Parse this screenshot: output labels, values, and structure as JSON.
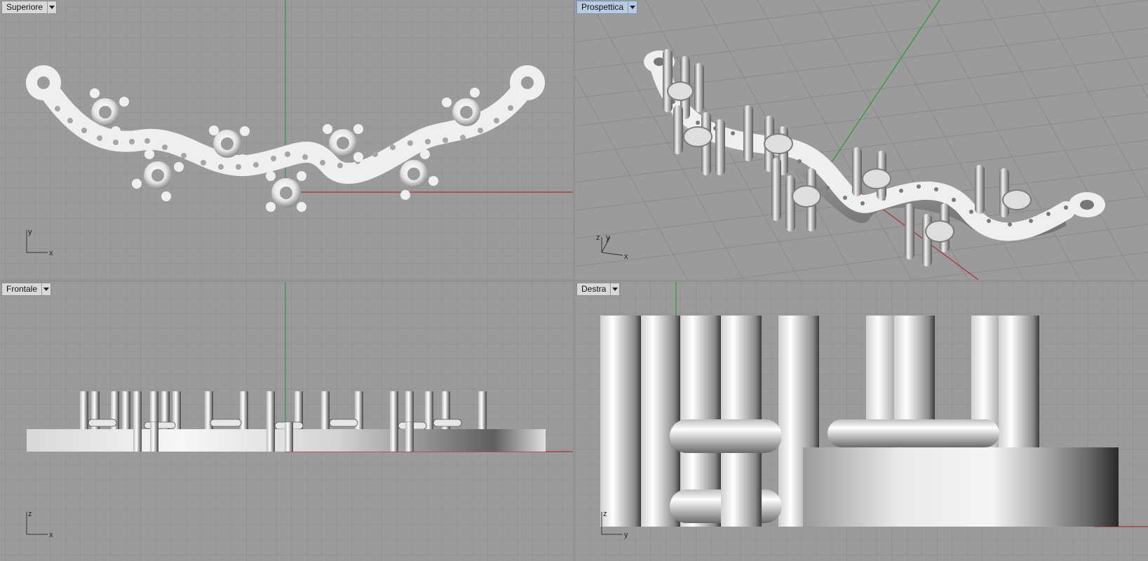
{
  "viewports": [
    {
      "id": "top",
      "title": "Superiore",
      "active": false,
      "axes": [
        "y",
        "x"
      ]
    },
    {
      "id": "perspective",
      "title": "Prospettica",
      "active": true,
      "axes": [
        "z",
        "y",
        "x"
      ]
    },
    {
      "id": "front",
      "title": "Frontale",
      "active": false,
      "axes": [
        "z",
        "x"
      ]
    },
    {
      "id": "right",
      "title": "Destra",
      "active": false,
      "axes": [
        "z",
        "y"
      ]
    }
  ],
  "colors": {
    "viewport_bg": "#9b9b9b",
    "grid_minor": "#8d8d8d",
    "grid_major": "#808080",
    "x_axis": "#b03030",
    "y_axis": "#2e9a2e",
    "object": "#ececec"
  },
  "icons": {
    "dropdown": "chevron-down-icon",
    "axis": "axis-indicator-icon"
  }
}
